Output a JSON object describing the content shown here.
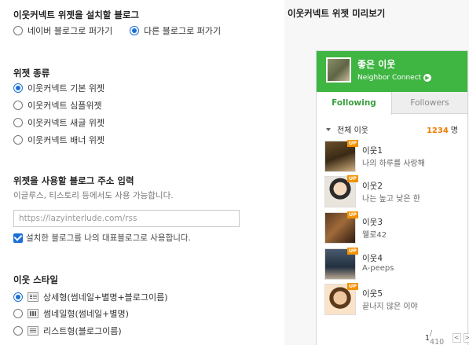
{
  "install": {
    "title": "이웃커넥트 위젯을 설치할 블로그",
    "options": [
      {
        "label": "네이버 블로그로 퍼가기",
        "selected": false
      },
      {
        "label": "다른 블로그로 퍼가기",
        "selected": true
      }
    ]
  },
  "widget_type": {
    "title": "위젯 종류",
    "options": [
      {
        "label": "이웃커넥트 기본 위젯",
        "selected": true
      },
      {
        "label": "이웃커넥트 심플위젯",
        "selected": false
      },
      {
        "label": "이웃커넥트 새글 위젯",
        "selected": false
      },
      {
        "label": "이웃커넥트 배너 위젯",
        "selected": false
      }
    ]
  },
  "blog_url": {
    "title": "위젯을 사용할 블로그 주소 입력",
    "hint": "이글루스, 티스토리 등에서도 사용 가능합니다.",
    "value": "https://lazyinterlude.com/rss",
    "checkbox_label": "설치한 블로그를 나의 대표블로그로 사용합니다.",
    "checked": true
  },
  "neighbor_style": {
    "title": "이웃 스타일",
    "options": [
      {
        "label": "상세형(썸네일+별명+블로그이름)",
        "icon": "detail-view-icon",
        "selected": true
      },
      {
        "label": "썸네일형(썸네일+별명)",
        "icon": "thumbnail-view-icon",
        "selected": false
      },
      {
        "label": "리스트형(블로그이름)",
        "icon": "list-view-icon",
        "selected": false
      }
    ]
  },
  "preview": {
    "title": "이웃커넥트 위젯 미리보기",
    "name": "좋은 이웃",
    "connect": "Neighbor Connect",
    "tabs": [
      "Following",
      "Followers"
    ],
    "filter": "전체 이웃",
    "count": "1234",
    "count_unit": "명",
    "badge": "UP",
    "neighbors": [
      {
        "name": "이웃1",
        "desc": "나의 하루를 사랑해"
      },
      {
        "name": "이웃2",
        "desc": "나는 높고 낮은 한"
      },
      {
        "name": "이웃3",
        "desc": "웰로42"
      },
      {
        "name": "이웃4",
        "desc": "A-peeps"
      },
      {
        "name": "이웃5",
        "desc": "끝나지 않은 이야"
      }
    ],
    "page_current": "1",
    "page_total": "/ 410",
    "prev": "<",
    "next": ">"
  },
  "colors": {
    "accent": "#1a6fd6",
    "widget_green": "#3fb542",
    "count_orange": "#f07c00"
  }
}
